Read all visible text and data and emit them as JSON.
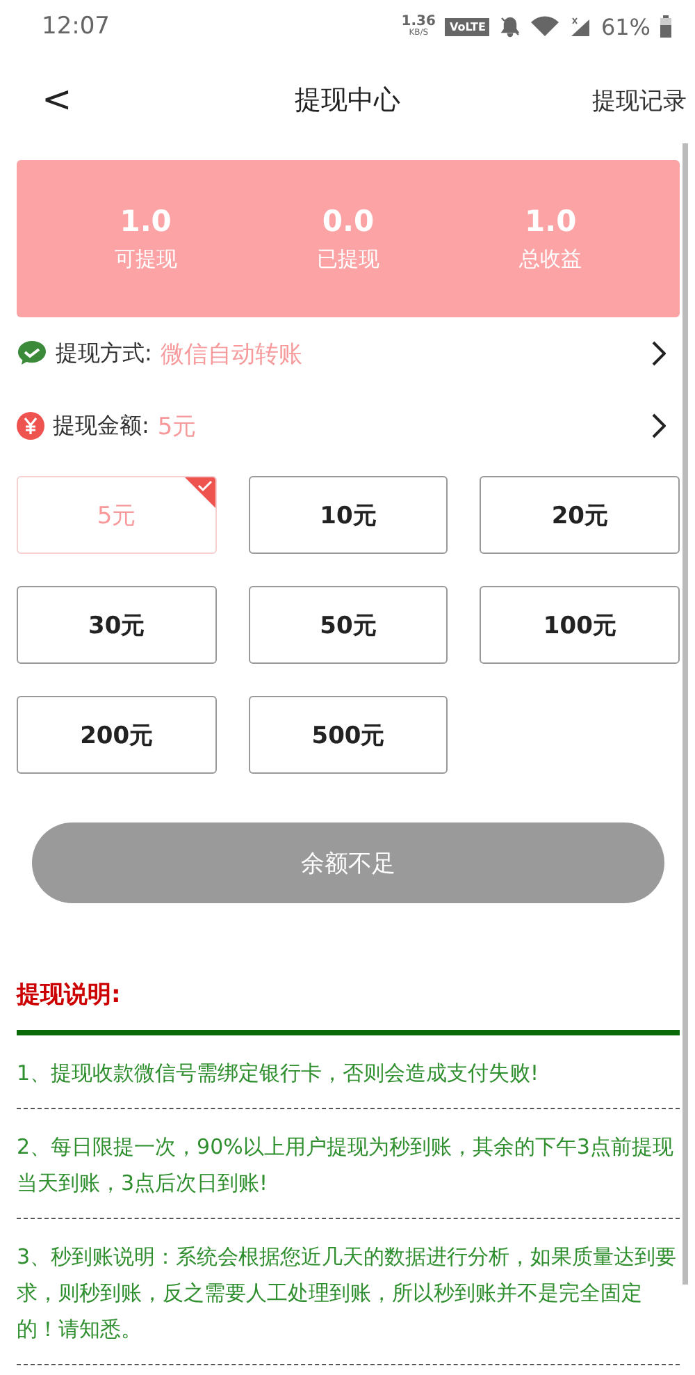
{
  "status_bar": {
    "time": "12:07",
    "net_speed": "1.36",
    "net_unit": "KB/S",
    "volte": "VoLTE",
    "battery": "61%"
  },
  "header": {
    "back": "<",
    "title": "提现中心",
    "action": "提现记录"
  },
  "stats": [
    {
      "value": "1.0",
      "label": "可提现"
    },
    {
      "value": "0.0",
      "label": "已提现"
    },
    {
      "value": "1.0",
      "label": "总收益"
    }
  ],
  "method": {
    "label": "提现方式:",
    "value": "微信自动转账"
  },
  "amount": {
    "label": "提现金额:",
    "value": "5元"
  },
  "options": [
    {
      "label": "5元",
      "selected": true
    },
    {
      "label": "10元",
      "selected": false
    },
    {
      "label": "20元",
      "selected": false
    },
    {
      "label": "30元",
      "selected": false
    },
    {
      "label": "50元",
      "selected": false
    },
    {
      "label": "100元",
      "selected": false
    },
    {
      "label": "200元",
      "selected": false
    },
    {
      "label": "500元",
      "selected": false
    }
  ],
  "submit": {
    "label": "余额不足",
    "disabled": true
  },
  "notes": {
    "title": "提现说明:",
    "items": [
      "1、提现收款微信号需绑定银行卡，否则会造成支付失败!",
      "2、每日限提一次，90%以上用户提现为秒到账，其余的下午3点前提现当天到账，3点后次日到账!",
      "3、秒到账说明：系统会根据您近几天的数据进行分析，如果质量达到要求，则秒到账，反之需要人工处理到账，所以秒到账并不是完全固定的！请知悉。"
    ]
  }
}
